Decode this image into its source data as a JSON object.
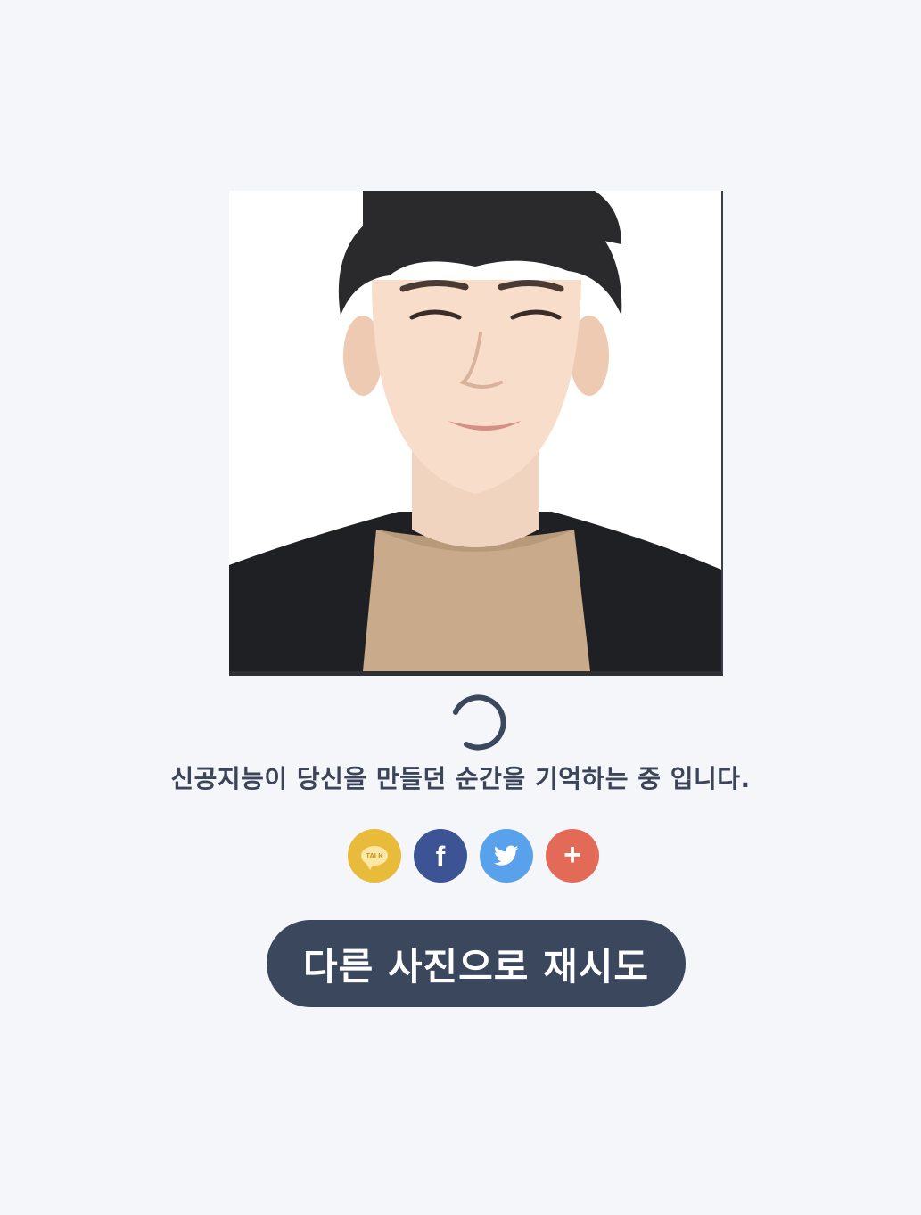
{
  "photo": {
    "subject": "portrait-photo"
  },
  "loading": {
    "status_text": "신공지능이 당신을 만들던 순간을 기억하는 중 입니다."
  },
  "share": {
    "buttons": [
      {
        "id": "kakao",
        "label": "TALK",
        "icon": "kakaotalk-icon",
        "color": "#e9bb3a"
      },
      {
        "id": "facebook",
        "label": "f",
        "icon": "facebook-icon",
        "color": "#3d5494"
      },
      {
        "id": "twitter",
        "label": "",
        "icon": "twitter-icon",
        "color": "#5aa1ec"
      },
      {
        "id": "more",
        "label": "+",
        "icon": "plus-icon",
        "color": "#e26a57"
      }
    ]
  },
  "actions": {
    "retry_label": "다른 사진으로 재시도"
  },
  "colors": {
    "background": "#f5f6fa",
    "primary": "#3a475c",
    "text": "#3b4458"
  }
}
